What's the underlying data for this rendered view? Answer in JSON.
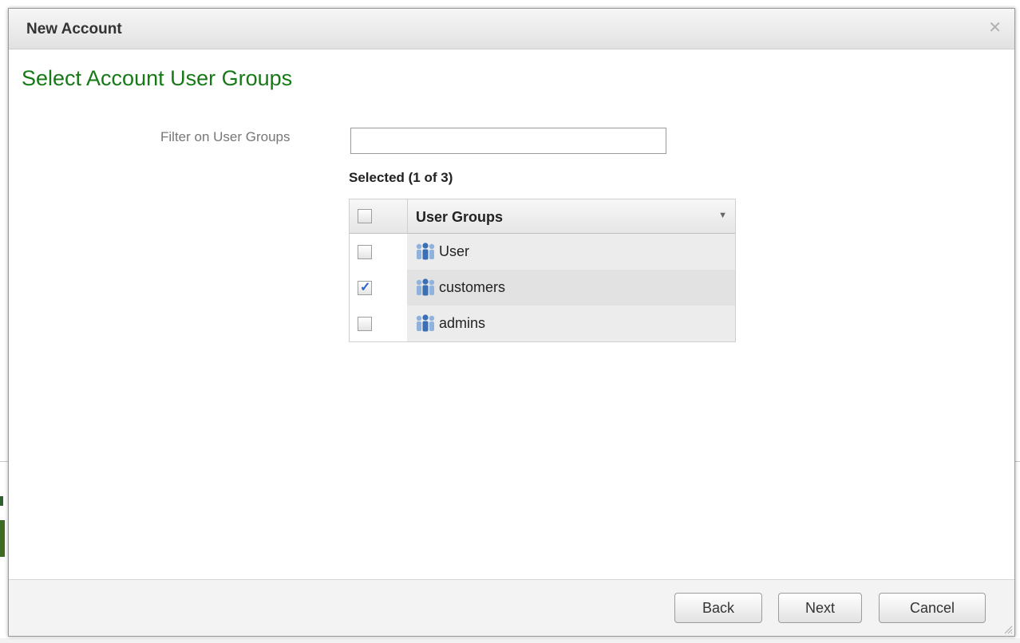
{
  "dialog": {
    "title": "New Account",
    "close_glyph": "✕",
    "heading": "Select Account User Groups"
  },
  "filter": {
    "label": "Filter on User Groups",
    "value": "",
    "placeholder": ""
  },
  "selection": {
    "summary": "Selected (1 of 3)"
  },
  "grid": {
    "column_header": "User Groups",
    "sort_glyph": "▼",
    "rows": [
      {
        "name": "User",
        "checked": false
      },
      {
        "name": "customers",
        "checked": true
      },
      {
        "name": "admins",
        "checked": false
      }
    ]
  },
  "footer": {
    "back_label": "Back",
    "next_label": "Next",
    "cancel_label": "Cancel"
  },
  "icons": {
    "close": "close-icon",
    "sort": "sort-desc-icon",
    "group": "user-group-icon",
    "checkbox": "checkbox-icon",
    "resize": "resize-grip-icon"
  },
  "colors": {
    "heading": "#157a15",
    "check": "#2a62c9"
  }
}
